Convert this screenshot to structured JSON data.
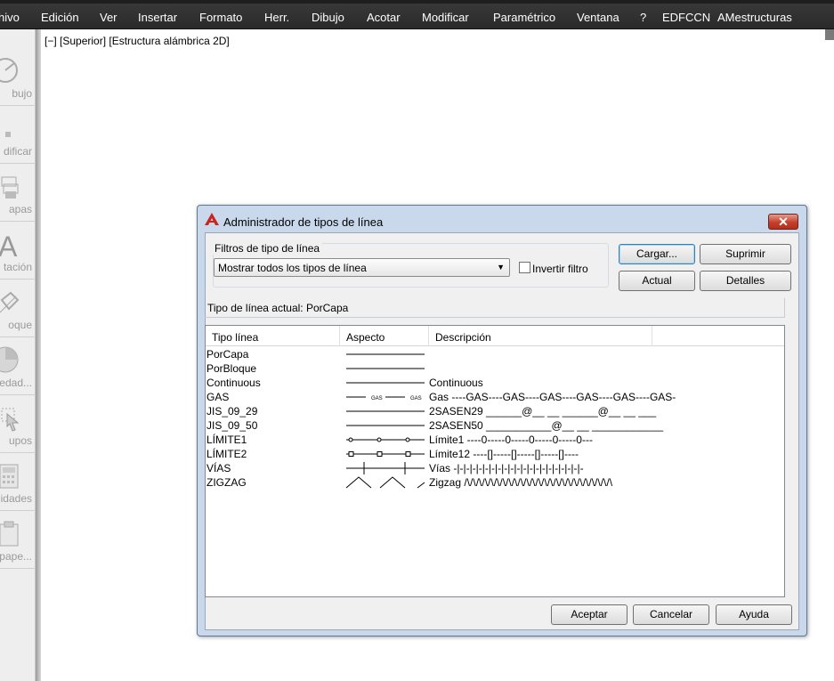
{
  "menu": [
    "hivo",
    "Edición",
    "Ver",
    "Insertar",
    "Formato",
    "Herr.",
    "Dibujo",
    "Acotar",
    "Modificar",
    "Paramétrico",
    "Ventana",
    "?",
    "EDFCCN",
    "AMestructuras"
  ],
  "ribbon": [
    {
      "label": "bujo",
      "icon": "draw-icon"
    },
    {
      "label": "dificar",
      "icon": "modify-icon"
    },
    {
      "label": "apas",
      "icon": "layers-icon"
    },
    {
      "label": "tación",
      "icon": "annotation-icon"
    },
    {
      "label": "oque",
      "icon": "block-icon"
    },
    {
      "label": "iedad...",
      "icon": "properties-icon"
    },
    {
      "label": "upos",
      "icon": "groups-icon"
    },
    {
      "label": "idades",
      "icon": "utilities-icon"
    },
    {
      "label": "tpape...",
      "icon": "clipboard-icon"
    }
  ],
  "viewport_label": "[−] [Superior] [Estructura alámbrica 2D]",
  "dialog": {
    "title": "Administrador de tipos de línea",
    "filters_legend": "Filtros de tipo de línea",
    "filter_value": "Mostrar todos los tipos de línea",
    "invert_label": "Invertir filtro",
    "invert_checked": false,
    "buttons": {
      "load": "Cargar...",
      "delete": "Suprimir",
      "current": "Actual",
      "details": "Detalles"
    },
    "current_linetype": "Tipo de línea actual:  PorCapa",
    "columns": [
      "Tipo línea",
      "Aspecto",
      "Descripción"
    ],
    "rows": [
      {
        "name": "PorCapa",
        "pattern": "solid",
        "desc": ""
      },
      {
        "name": "PorBloque",
        "pattern": "solid",
        "desc": ""
      },
      {
        "name": "Continuous",
        "pattern": "solid",
        "desc": "Continuous"
      },
      {
        "name": "GAS",
        "pattern": "gas",
        "desc": "Gas ----GAS----GAS----GAS----GAS----GAS----GAS-"
      },
      {
        "name": "JIS_09_29",
        "pattern": "solid",
        "desc": "2SASEN29 ______@__  __  ______@__  __  ___"
      },
      {
        "name": "JIS_09_50",
        "pattern": "solid",
        "desc": "2SASEN50 ___________@__  __  ____________"
      },
      {
        "name": "LÍMITE1",
        "pattern": "boundary1",
        "desc": "Límite1 ----0-----0-----0-----0-----0---"
      },
      {
        "name": "LÍMITE2",
        "pattern": "boundary2",
        "desc": "Límite12 ----[]-----[]-----[]-----[]----"
      },
      {
        "name": "VÍAS",
        "pattern": "tracks",
        "desc": "Vías -|-|-|-|-|-|-|-|-|-|-|-|-|-|-|-|-|-|-|-|-"
      },
      {
        "name": "ZIGZAG",
        "pattern": "zigzag",
        "desc": "Zigzag /\\/\\/\\/\\/\\/\\/\\/\\/\\/\\/\\/\\/\\/\\/\\/\\/\\/\\/\\/\\/\\/\\/\\/\\/\\"
      }
    ],
    "bottom_buttons": {
      "accept": "Aceptar",
      "cancel": "Cancelar",
      "help": "Ayuda"
    },
    "gas_mark": "GAS"
  }
}
